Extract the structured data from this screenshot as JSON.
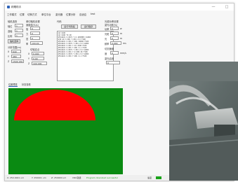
{
  "window": {
    "title": "精雕助手",
    "controls": [
      "—",
      "□"
    ]
  },
  "menu": [
    "工作模式",
    "位置",
    "切换方式",
    "单位平台",
    "激光器",
    "位置分析",
    "自适应",
    "test"
  ],
  "panel_axis": {
    "title": "轴机选择",
    "rows": [
      {
        "label": "轴位",
        "value": "1"
      },
      {
        "label": "选轴",
        "value": "1"
      },
      {
        "label": "比例",
        "value": "1"
      }
    ],
    "button": "轴机选择",
    "sub_title": "分析范围(m)",
    "coords": [
      {
        "label": "X",
        "value": "640"
      },
      {
        "label": "Y",
        "value": "480"
      },
      {
        "label": "Z",
        "value": "1500 150"
      }
    ]
  },
  "panel_single": {
    "title": "单切轴机设置",
    "subtitle": "速度值(%/s)",
    "rows": [
      {
        "label": "值",
        "value": "0"
      },
      {
        "label": "力",
        "value": "0"
      },
      {
        "label": "范",
        "value": "0"
      },
      {
        "label": "率",
        "value": "100.00"
      }
    ],
    "sub_title": "切轴定点",
    "points": [
      {
        "label": "X",
        "value": "0.000"
      },
      {
        "label": "Y",
        "value": "0.00"
      },
      {
        "label": "Z",
        "value": "100 000"
      }
    ]
  },
  "panel_code": {
    "title": "代码",
    "buttons": [
      "运行代码段",
      "运行程序"
    ],
    "lines": [
      "G0 X100",
      "G0 X100 Y0 Z0",
      "#5=G021 X-0071 Y-0.1095M03 S1000",
      "#10 G0 X-001 Y-001 Z-0 F100",
      "#5=G021 X-001 Y-001 S0000 F100",
      "#5=G021 X-0071 Y-001 Z-0 S1000",
      "#5=G021 X-001 Y-01 Z100 F100",
      "#5=G021 X-001 Y-001 Z-1 F100",
      "#5=G021 X-0071 Y-001 Z-0 S1000",
      "#5=G021 X-001 Y-0.009 Z0 F100",
      "#5=G021 X-0071 Y-001 Z-0 S1000",
      "#5=G021 X-001 Y-001 Z-1 F100"
    ]
  },
  "panel_laser": {
    "title": "光源功率设置",
    "subtitle": "激光功率(%)",
    "rows": [
      {
        "label": "功率",
        "value": "0",
        "unit": "w"
      },
      {
        "label": "光斑",
        "value": "0",
        "unit": "m"
      },
      {
        "label": "光",
        "value": "0",
        "unit": "m"
      },
      {
        "label": "频率",
        "value": "0.000",
        "unit": "ms"
      }
    ],
    "speed_title": "切割速度",
    "speed_row": {
      "label": "速",
      "value": "0",
      "unit": "mm/s"
    },
    "mode_title": "激光启用",
    "mode_value": "0"
  },
  "tabs": [
    "位置预览",
    "状态查看"
  ],
  "preview": {
    "canvas_color": "#0a8a12",
    "shape_color": "#ff0000"
  },
  "status_bar": {
    "segments": [
      "X: 250.0001 um",
      "Y: 250001 um",
      "Z: 250000 um",
      "CNC就绪"
    ],
    "message": "Program download successful",
    "tail": "速度"
  }
}
